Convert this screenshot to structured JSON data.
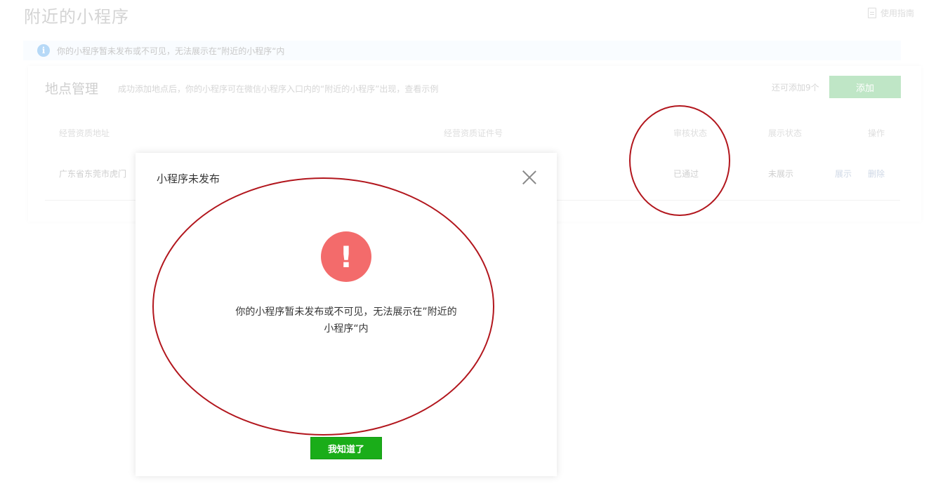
{
  "page": {
    "title": "附近的小程序",
    "guide_link": "使用指南"
  },
  "notice": {
    "icon": "info-icon",
    "text": "你的小程序暂未发布或不可见，无法展示在”附近的小程序“内"
  },
  "section": {
    "title": "地点管理",
    "description": "成功添加地点后，你的小程序可在微信小程序入口内的“附近的小程序”出现，查看示例",
    "remaining": "还可添加9个",
    "add_button": "添加"
  },
  "table": {
    "headers": {
      "address": "经营资质地址",
      "license": "经营资质证件号",
      "review": "审核状态",
      "display": "展示状态",
      "actions": "操作"
    },
    "rows": [
      {
        "address": "广东省东莞市虎门",
        "review": "已通过",
        "display": "未展示",
        "action_show": "展示",
        "action_delete": "删除"
      }
    ]
  },
  "dialog": {
    "title": "小程序未发布",
    "icon": "exclamation-icon",
    "message_line1": "你的小程序暂未发布或不可见，无法展示在”附近的",
    "message_line2": "小程序“内",
    "confirm_button": "我知道了",
    "accent_color": "#1aad19",
    "warning_color": "#f36b6b"
  },
  "annotation_color": "#b2161d"
}
